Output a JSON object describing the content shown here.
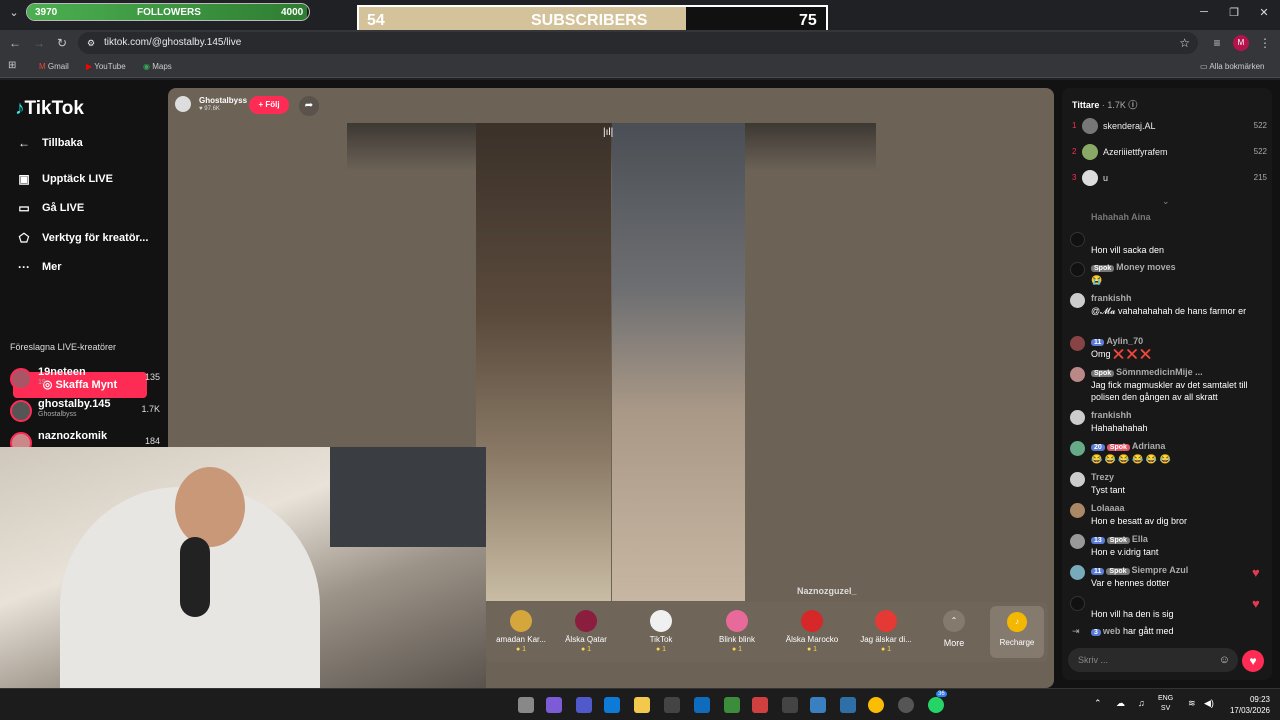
{
  "overlays": {
    "followers": {
      "current": "3970",
      "label": "FOLLOWERS",
      "goal": "4000",
      "progress": 0.9925
    },
    "subscribers": {
      "current": "54",
      "label": "SUBSCRIBERS",
      "goal": "75",
      "progress": 0.7
    }
  },
  "browser": {
    "url": "tiktok.com/@ghostalby.145/live",
    "bookmarks": [
      "Gmail",
      "YouTube",
      "Maps"
    ],
    "all_bookmarks": "Alla bokmärken",
    "profile_initial": "M"
  },
  "sidebar": {
    "logo": "TikTok",
    "back": "Tillbaka",
    "items": [
      "Upptäck LIVE",
      "Gå LIVE",
      "Verktyg för kreatör...",
      "Mer"
    ],
    "buy_button": "Skaffa Mynt",
    "section_title": "Föreslagna LIVE-kreatörer",
    "creators": [
      {
        "name": "19neteen",
        "sub": "19",
        "count": "135"
      },
      {
        "name": "ghostalby.145",
        "sub": "Ghostalbyss",
        "count": "1.7K"
      },
      {
        "name": "naznozkomik",
        "sub": "",
        "count": "184"
      }
    ]
  },
  "stream": {
    "host_name": "Ghostalbyss",
    "host_likes": "97.6K",
    "follow": "+ Följ",
    "guest_name": "Naznozguzel_",
    "gifts": [
      {
        "name": "amadan Kar...",
        "price": "1"
      },
      {
        "name": "Älska Qatar",
        "price": "1"
      },
      {
        "name": "TikTok",
        "price": "1"
      },
      {
        "name": "Blink blink",
        "price": "1"
      },
      {
        "name": "Älska Marocko",
        "price": "1"
      },
      {
        "name": "Jag älskar di...",
        "price": "1"
      }
    ],
    "more": "More",
    "recharge": "Recharge"
  },
  "chat": {
    "viewers_title": "Tittare",
    "viewers_count": "· 1.7K",
    "top_viewers": [
      {
        "rank": "1",
        "name": "skenderaj.AL",
        "score": "522"
      },
      {
        "rank": "2",
        "name": "Azeriiiettfyrafem",
        "score": "522"
      },
      {
        "rank": "3",
        "name": "u",
        "score": "215"
      }
    ],
    "messages": [
      {
        "user": "Hahahah Aina",
        "badges": [],
        "text": ""
      },
      {
        "user": "",
        "badges": [],
        "text": "Hon vill sacka den"
      },
      {
        "user": "Money moves",
        "badges": [
          "Spok"
        ],
        "text": "😭"
      },
      {
        "user": "frankishh",
        "badges": [],
        "text": "@𝓜𝓪 vahahahahah de hans farmor er"
      },
      {
        "user": "Aylin_70",
        "badges": [
          "11"
        ],
        "text": "Omg ❌ ❌ ❌"
      },
      {
        "user": "SömnmedicinMije ...",
        "badges": [
          "Spok"
        ],
        "text": "Jag fick magmuskler av det samtalet till polisen den gången av all skratt"
      },
      {
        "user": "frankishh",
        "badges": [],
        "text": "Hahahahahah"
      },
      {
        "user": "Adriana",
        "badges": [
          "20",
          "Spok"
        ],
        "text": "😂 😂 😂 😂 😂 😂"
      },
      {
        "user": "Trezy",
        "badges": [],
        "text": "Tyst tant"
      },
      {
        "user": "Lolaaaa",
        "badges": [],
        "text": "Hon e besatt av dig bror"
      },
      {
        "user": "Ella",
        "badges": [
          "13",
          "Spok"
        ],
        "text": "Hon e v.idrig tant"
      },
      {
        "user": "Siempre Azul",
        "badges": [
          "11",
          "Spok"
        ],
        "text": "Var e hennes dotter"
      },
      {
        "user": "",
        "badges": [],
        "text": "Hon vill ha den is sig"
      }
    ],
    "join_user": "web",
    "join_badge": "3",
    "join_text": "har gått med",
    "input_placeholder": "Skriv ..."
  },
  "taskbar": {
    "lang": "ENG",
    "lang2": "SV",
    "time": "09:23",
    "date": "17/03/2026",
    "badge": "36"
  }
}
